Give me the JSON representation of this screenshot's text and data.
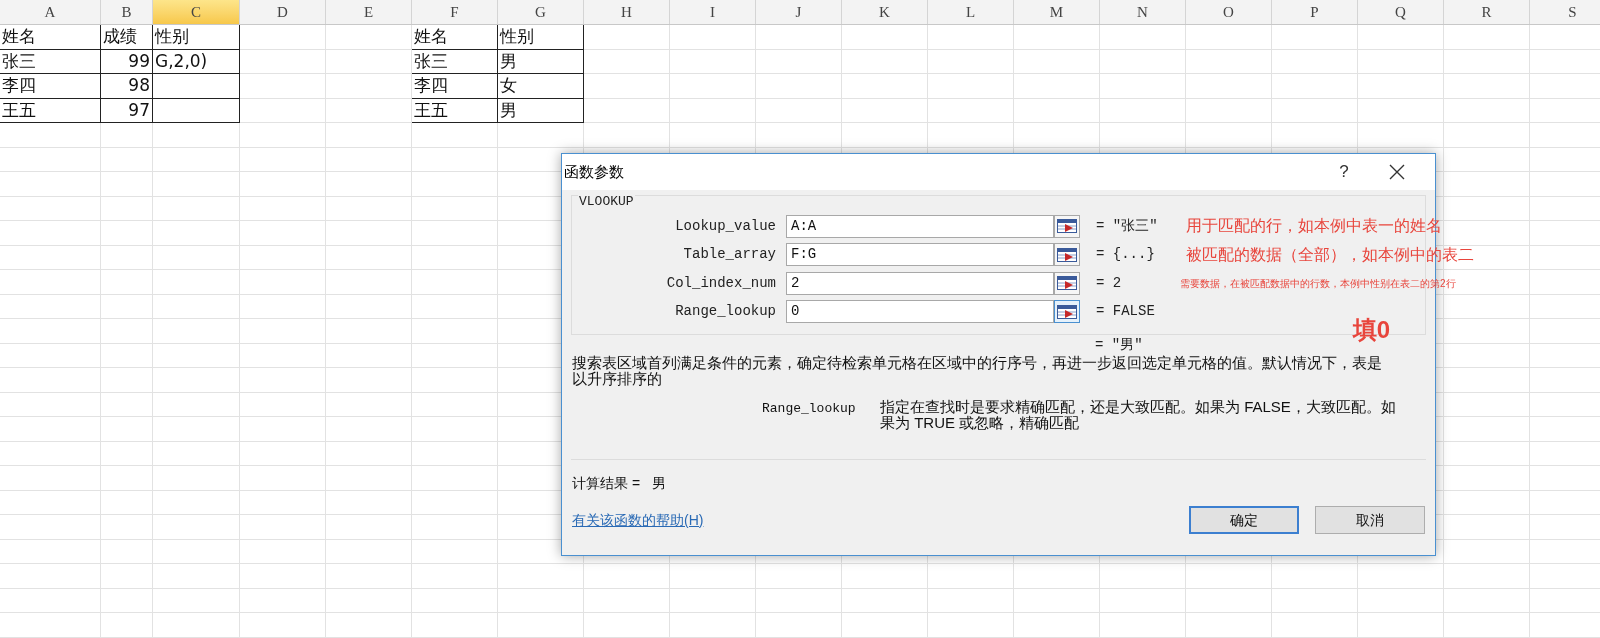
{
  "columns": [
    {
      "label": "A",
      "selected": false
    },
    {
      "label": "B",
      "selected": false
    },
    {
      "label": "C",
      "selected": true
    },
    {
      "label": "D",
      "selected": false
    },
    {
      "label": "E",
      "selected": false
    },
    {
      "label": "F",
      "selected": false
    },
    {
      "label": "G",
      "selected": false
    },
    {
      "label": "H",
      "selected": false
    },
    {
      "label": "I",
      "selected": false
    },
    {
      "label": "J",
      "selected": false
    },
    {
      "label": "K",
      "selected": false
    },
    {
      "label": "L",
      "selected": false
    },
    {
      "label": "M",
      "selected": false
    },
    {
      "label": "N",
      "selected": false
    },
    {
      "label": "O",
      "selected": false
    },
    {
      "label": "P",
      "selected": false
    },
    {
      "label": "Q",
      "selected": false
    },
    {
      "label": "R",
      "selected": false
    },
    {
      "label": "S",
      "selected": false
    }
  ],
  "table_1": {
    "headers": [
      "姓名",
      "成绩",
      "性别"
    ],
    "rows": [
      {
        "name": "张三",
        "score": "99",
        "gender": "G,2,0)"
      },
      {
        "name": "李四",
        "score": "98"
      },
      {
        "name": "王五",
        "score": "97"
      }
    ]
  },
  "table_2": {
    "headers": [
      "姓名",
      "性别"
    ],
    "rows": [
      {
        "name": "张三",
        "gender": "男"
      },
      {
        "name": "李四",
        "gender": "女"
      },
      {
        "name": "王五",
        "gender": "男"
      }
    ]
  },
  "dialog": {
    "title": "函数参数",
    "help": "?",
    "function_name": "VLOOKUP",
    "args": [
      {
        "label": "Lookup_value",
        "value": "A:A",
        "result": "= \"张三\"",
        "note": {
          "text": "用于匹配的行，如本例中表一的姓名",
          "kind": "large"
        }
      },
      {
        "label": "Table_array",
        "value": "F:G",
        "result": "= {...}",
        "note": {
          "text": "被匹配的数据（全部），如本例中的表二",
          "kind": "large"
        }
      },
      {
        "label": "Col_index_num",
        "value": "2",
        "result": "= 2",
        "note": {
          "text": "需要数据，在被匹配数据中的行数，本例中性别在表二的第2行",
          "kind": "small"
        }
      },
      {
        "label": "Range_lookup",
        "value": "0",
        "result": "= FALSE"
      }
    ],
    "callout": "填0",
    "formula_result": "= \"男\"",
    "description": "搜索表区域首列满足条件的元素，确定待检索单元格在区域中的行序号，再进一步返回选定单元格的值。默认情况下，表是以升序排序的",
    "arg_help": {
      "name": "Range_lookup",
      "text": "指定在查找时是要求精确匹配，还是大致匹配。如果为 FALSE，大致匹配。如果为 TRUE 或忽略，精确匹配"
    },
    "calc_label": "计算结果 =",
    "calc_value": "男",
    "help_link": "有关该函数的帮助(H)",
    "buttons": [
      {
        "label": "确定",
        "selected": true
      },
      {
        "label": "取消",
        "selected": false
      }
    ]
  }
}
